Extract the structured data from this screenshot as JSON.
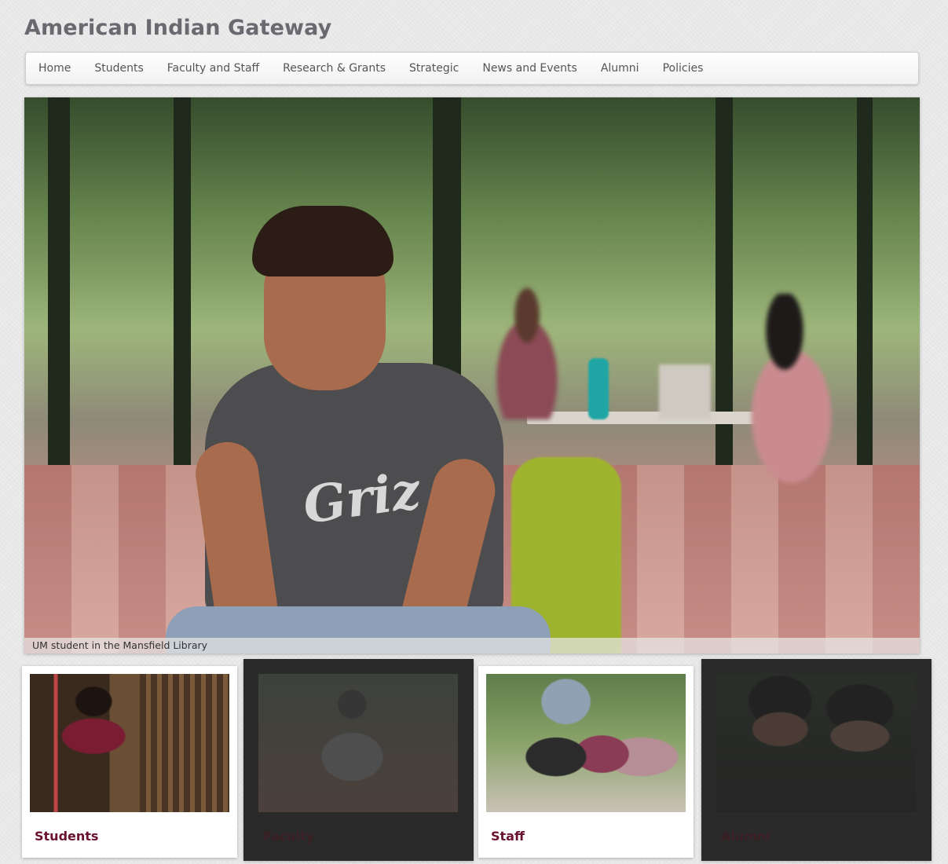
{
  "site": {
    "title": "American Indian Gateway"
  },
  "nav": {
    "items": [
      {
        "label": "Home"
      },
      {
        "label": "Students"
      },
      {
        "label": "Faculty and Staff"
      },
      {
        "label": "Research & Grants"
      },
      {
        "label": "Strategic"
      },
      {
        "label": "News and Events"
      },
      {
        "label": "Alumni"
      },
      {
        "label": "Policies"
      }
    ]
  },
  "hero": {
    "caption": "UM student in the Mansfield Library",
    "shirt_text": "Griz"
  },
  "cards": [
    {
      "label": "Students",
      "state": "active"
    },
    {
      "label": "Faculty",
      "state": "dimmed"
    },
    {
      "label": "Staff",
      "state": "active"
    },
    {
      "label": "Alumni",
      "state": "dimmed"
    }
  ],
  "colors": {
    "accent": "#6a1230",
    "title": "#6b6870",
    "nav_text": "#555555",
    "page_bg": "#e8e8e8"
  }
}
